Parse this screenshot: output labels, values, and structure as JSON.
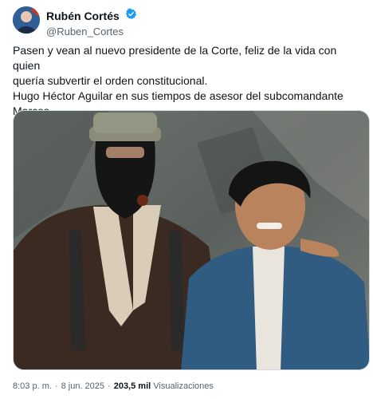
{
  "author": {
    "display_name": "Rubén Cortés",
    "handle": "@Ruben_Cortes",
    "verified": true,
    "avatar_icon": "profile-avatar",
    "verified_icon": "verified-badge-icon"
  },
  "tweet": {
    "text_lines": [
      "Pasen y vean al nuevo presidente de la Corte, feliz de la vida  con quien",
      "quería subvertir  el orden constitucional.",
      "Hugo Héctor Aguilar en sus tiempos de asesor del subcomandante",
      "Marcos."
    ],
    "media_icon": "photo"
  },
  "meta": {
    "time": "8:03 p. m.",
    "separator": "·",
    "date": "8 jun. 2025",
    "views_count": "203,5 mil",
    "views_label": "Visualizaciones"
  },
  "colors": {
    "text": "#0f1419",
    "secondary": "#536471",
    "verified": "#1d9bf0"
  }
}
